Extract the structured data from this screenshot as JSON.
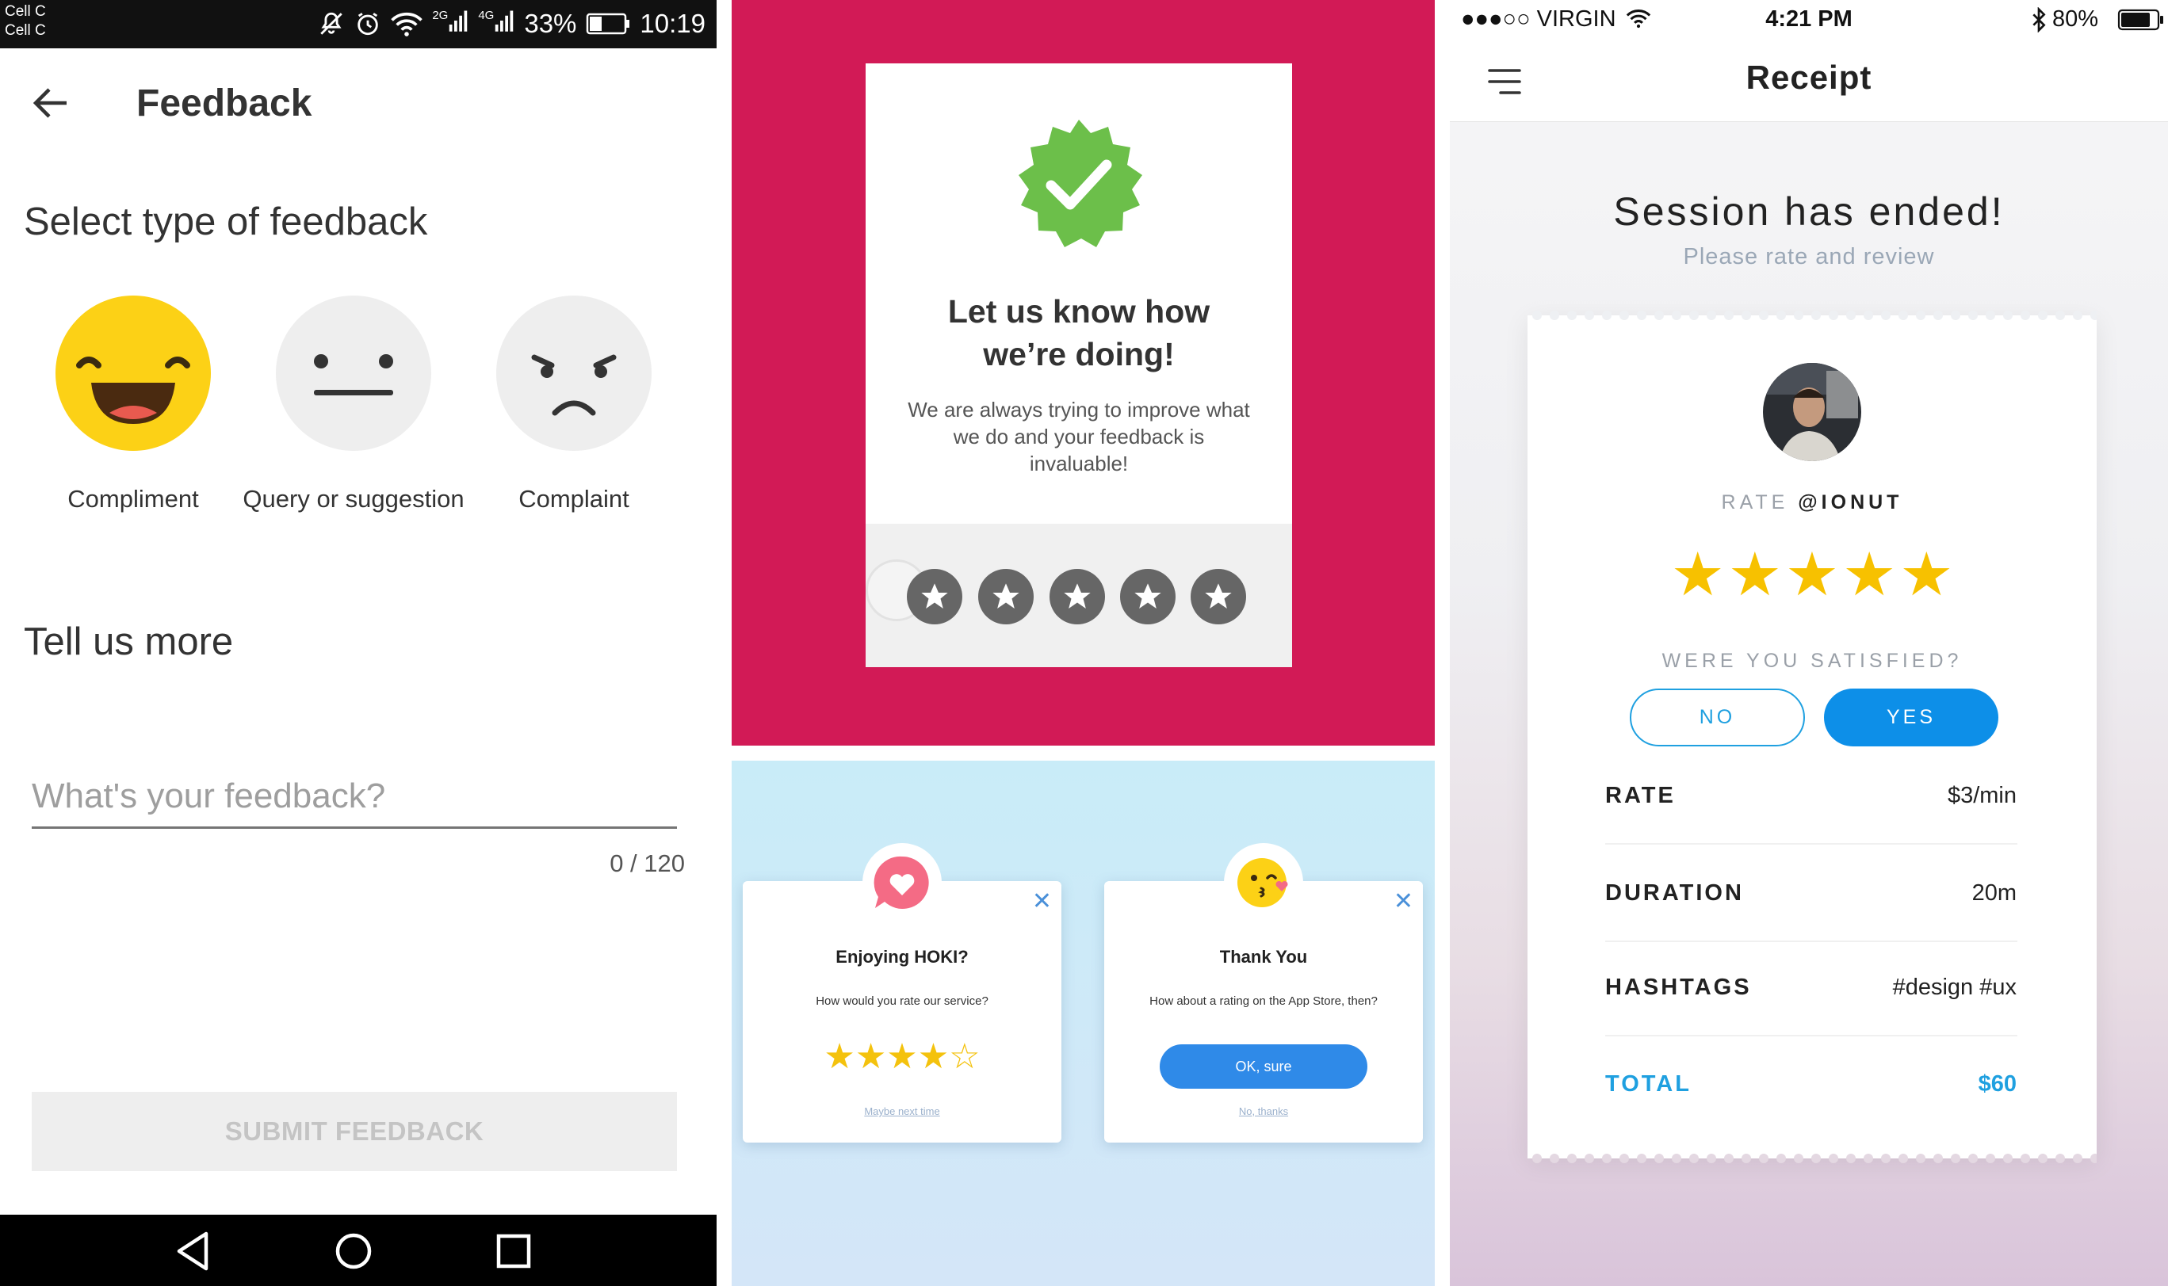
{
  "panel_feedback": {
    "status": {
      "carrier1": "Cell C",
      "carrier2": "Cell C",
      "net1": "2G",
      "net2": "4G",
      "battery": "33%",
      "time": "10:19",
      "icons": [
        "mute-icon",
        "alarm-icon",
        "wifi-icon",
        "signal-icon",
        "battery-icon"
      ]
    },
    "title": "Feedback",
    "select_heading": "Select type of feedback",
    "options": [
      {
        "label": "Compliment",
        "icon": "happy-face-icon",
        "color": "#fcd116"
      },
      {
        "label": "Query or suggestion",
        "icon": "neutral-face-icon",
        "color": "#eeeeee"
      },
      {
        "label": "Complaint",
        "icon": "angry-face-icon",
        "color": "#eeeeee"
      }
    ],
    "tell_heading": "Tell us more",
    "input_placeholder": "What's your feedback?",
    "counter": "0 / 120",
    "submit_label": "SUBMIT FEEDBACK"
  },
  "panel_rating": {
    "heading_line1": "Let us know how",
    "heading_line2": "we’re doing!",
    "body": "We are always trying to improve what we do and your feedback is invaluable!",
    "badge_color": "#6cbf4a",
    "background": "#d21a56",
    "star_count": 5
  },
  "panel_dialogs": {
    "dialog1": {
      "title": "Enjoying HOKI?",
      "text": "How would you rate our service?",
      "rating": 4,
      "out_of": 5,
      "link": "Maybe next time",
      "icon": "heart-bubble-icon"
    },
    "dialog2": {
      "title": "Thank You",
      "text": "How about a rating on the App Store, then?",
      "button": "OK, sure",
      "link": "No, thanks",
      "icon": "kiss-emoji-icon"
    }
  },
  "panel_receipt": {
    "status": {
      "carrier": "●●●○○ VIRGIN",
      "time": "4:21 PM",
      "battery": "80%"
    },
    "title": "Receipt",
    "session": "Session has ended!",
    "subtitle": "Please rate and review",
    "rate_prefix": "RATE ",
    "rate_user": "@IONUT",
    "stars": 5,
    "satisfied_q": "WERE YOU SATISFIED?",
    "btn_no": "NO",
    "btn_yes": "YES",
    "rows": [
      {
        "key": "RATE",
        "value": "$3/min"
      },
      {
        "key": "DURATION",
        "value": "20m"
      },
      {
        "key": "HASHTAGS",
        "value": "#design #ux"
      }
    ],
    "total": {
      "key": "TOTAL",
      "value": "$60"
    },
    "accent": "#1fa0e0"
  }
}
